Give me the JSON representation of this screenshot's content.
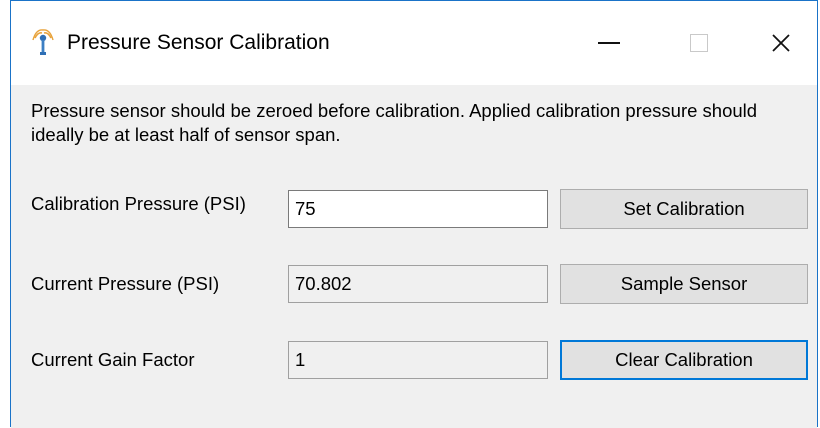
{
  "window": {
    "title": "Pressure Sensor Calibration",
    "controls": {
      "minimize": "minimize",
      "maximize": "maximize",
      "close": "✕"
    }
  },
  "intro_text": "Pressure sensor should be zeroed before calibration. Applied calibration pressure should ideally be at least half of sensor span.",
  "fields": {
    "calibration_pressure": {
      "label": "Calibration Pressure (PSI)",
      "value": "75"
    },
    "current_pressure": {
      "label": "Current Pressure (PSI)",
      "value": "70.802"
    },
    "current_gain": {
      "label": "Current Gain Factor",
      "value": "1"
    }
  },
  "buttons": {
    "set_calibration": "Set Calibration",
    "sample_sensor": "Sample Sensor",
    "clear_calibration": "Clear Calibration"
  },
  "colors": {
    "window_border": "#1a73c8",
    "default_button_border": "#0078d7",
    "client_background": "#f0f0f0"
  }
}
